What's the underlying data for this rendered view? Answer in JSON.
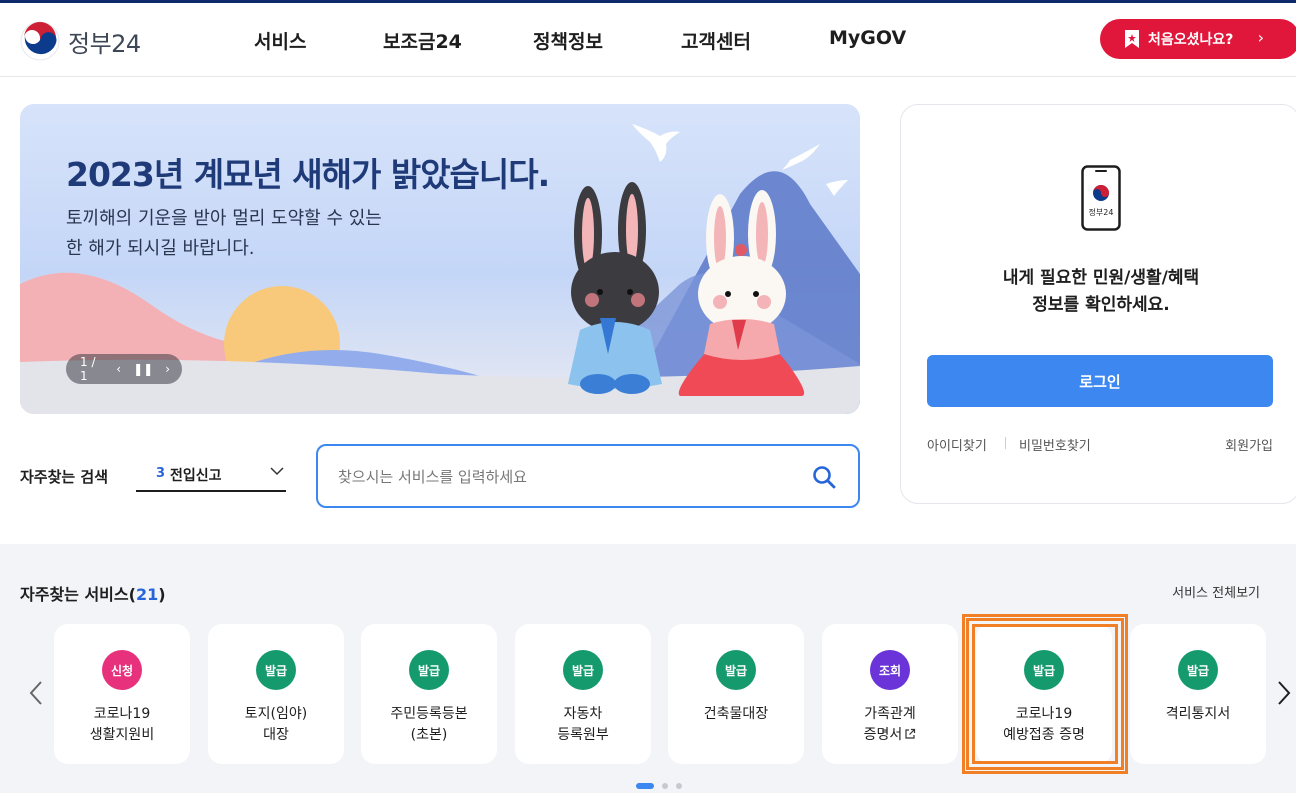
{
  "header": {
    "logo_text": "정부24",
    "nav": [
      "서비스",
      "보조금24",
      "정책정보",
      "고객센터",
      "MyGOV"
    ],
    "first_visit": "처음오셨나요?"
  },
  "banner": {
    "title": "2023년 계묘년 새해가 밝았습니다.",
    "subtitle_line1": "토끼해의 기운을 받아 멀리 도약할 수 있는",
    "subtitle_line2": "한 해가 되시길 바랍니다.",
    "pager": "1 / 1"
  },
  "login": {
    "phone_label": "정부24",
    "message_line1": "내게 필요한 민원/생활/혜택",
    "message_line2": "정보를 확인하세요.",
    "login_button": "로그인",
    "find_id": "아이디찾기",
    "find_password": "비밀번호찾기",
    "signup": "회원가입"
  },
  "search": {
    "frequent_label": "자주찾는 검색",
    "selected_rank": "3",
    "selected_value": "전입신고",
    "placeholder": "찾으시는 서비스를 입력하세요"
  },
  "services": {
    "title": "자주찾는 서비스(",
    "count": "21",
    "title_close": ")",
    "view_all": "서비스 전체보기",
    "items": [
      {
        "badge": "신청",
        "line1": "코로나19",
        "line2": "생활지원비",
        "color": "#e8317d"
      },
      {
        "badge": "발급",
        "line1": "토지(임야)",
        "line2": "대장",
        "color": "#159a6e"
      },
      {
        "badge": "발급",
        "line1": "주민등록등본",
        "line2": "(초본)",
        "color": "#159a6e"
      },
      {
        "badge": "발급",
        "line1": "자동차",
        "line2": "등록원부",
        "color": "#159a6e"
      },
      {
        "badge": "발급",
        "line1": "건축물대장",
        "line2": "",
        "color": "#159a6e"
      },
      {
        "badge": "조회",
        "line1": "가족관계",
        "line2": "증명서",
        "color": "#6a34d9"
      },
      {
        "badge": "발급",
        "line1": "코로나19",
        "line2": "예방접종 증명",
        "color": "#159a6e"
      },
      {
        "badge": "발급",
        "line1": "격리통지서",
        "line2": "",
        "color": "#159a6e"
      }
    ]
  },
  "colors": {
    "primary": "#3c87f0",
    "accent_red": "#e0173b",
    "highlight": "#f07f26"
  }
}
